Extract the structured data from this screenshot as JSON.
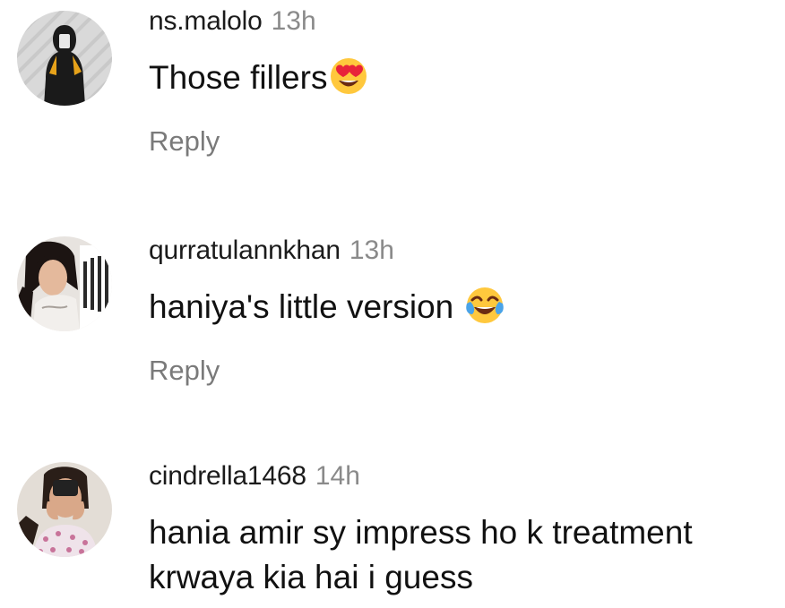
{
  "comments": [
    {
      "username": "ns.malolo",
      "time": "13h",
      "text": "Those fillers",
      "emoji": "heart-eyes-emoji",
      "reply": "Reply"
    },
    {
      "username": "qurratulannkhan",
      "time": "13h",
      "text": "haniya's little version ",
      "emoji": "tears-of-joy-emoji",
      "reply": "Reply"
    },
    {
      "username": "cindrella1468",
      "time": "14h",
      "text_line1": "hania amir sy impress ho k treatment",
      "text_line2": "krwaya kia hai i guess"
    }
  ],
  "colors": {
    "username": "#1b1b1b",
    "time": "#8a8a8a",
    "reply": "#7a7a7a",
    "emoji_yellow": "#ffc83d",
    "heart_red": "#e8233a",
    "tear_blue": "#4aa3e8"
  }
}
